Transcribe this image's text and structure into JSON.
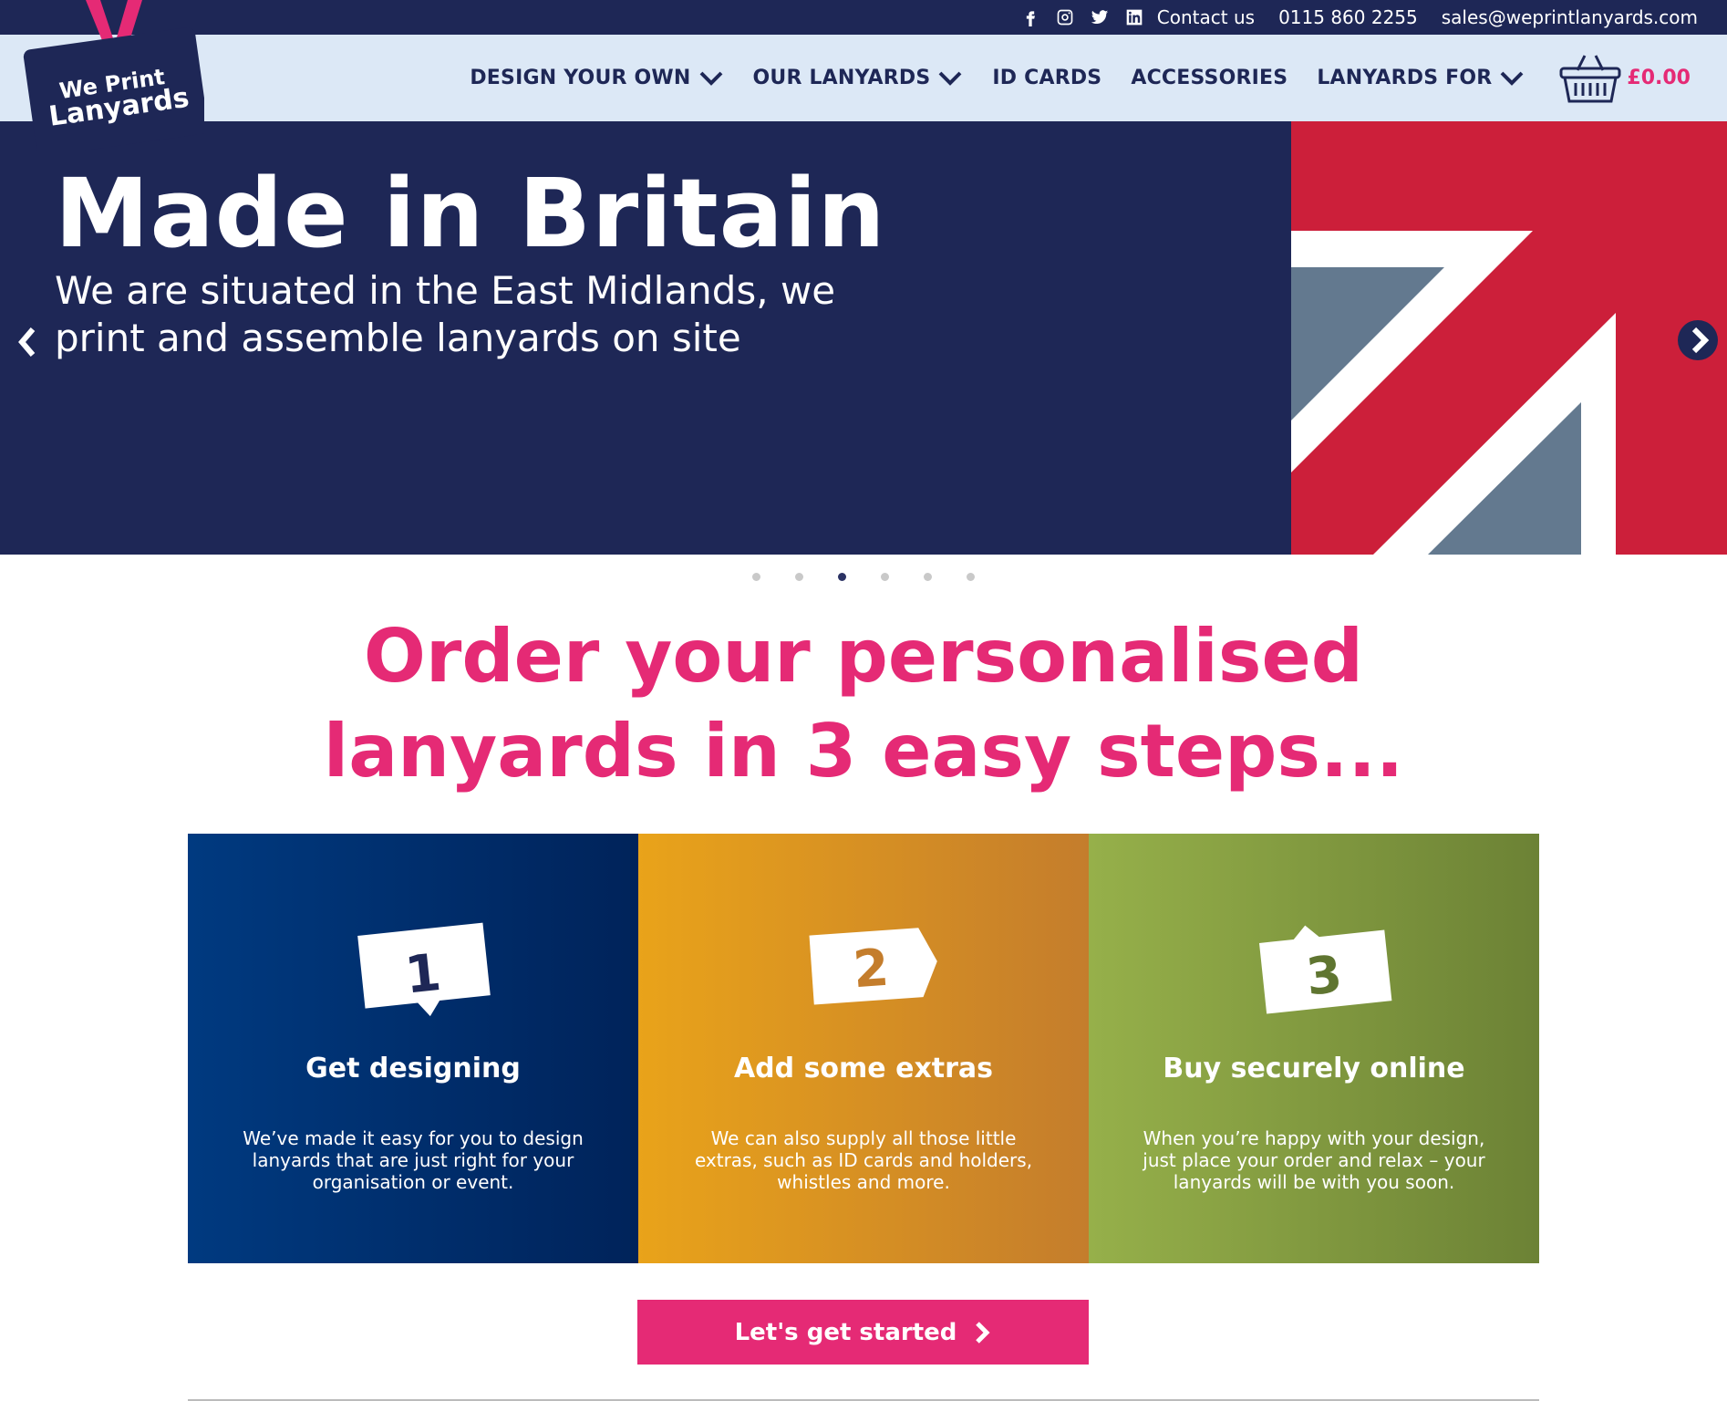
{
  "topbar": {
    "social": [
      "facebook-icon",
      "instagram-icon",
      "twitter-icon",
      "linkedin-icon"
    ],
    "contact_label": "Contact us",
    "phone": "0115 860 2255",
    "email": "sales@weprintlanyards.com"
  },
  "logo": {
    "line1": "We Print",
    "line2": "Lanyards"
  },
  "nav": {
    "items": [
      {
        "label": "DESIGN YOUR OWN",
        "dropdown": true
      },
      {
        "label": "OUR LANYARDS",
        "dropdown": true
      },
      {
        "label": "ID CARDS",
        "dropdown": false
      },
      {
        "label": "ACCESSORIES",
        "dropdown": false
      },
      {
        "label": "LANYARDS FOR",
        "dropdown": true
      }
    ],
    "cart_total": "£0.00"
  },
  "hero": {
    "title": "Made in Britain",
    "subtitle": "We are situated in the East Midlands, we print and assemble lanyards on site",
    "slide_count": 6,
    "active_slide": 3
  },
  "headline": {
    "line1": "Order your personalised",
    "line2": "lanyards in 3 easy steps..."
  },
  "steps": [
    {
      "number": "1",
      "title": "Get designing",
      "desc": "We’ve made it easy for you to design lanyards that are just right for your organisation or event."
    },
    {
      "number": "2",
      "title": "Add some extras",
      "desc": "We can also supply all those little extras, such as ID cards and holders, whistles and more."
    },
    {
      "number": "3",
      "title": "Buy securely online",
      "desc": "When you’re happy with your design, just place your order and relax – your lanyards will be with you soon."
    }
  ],
  "cta": {
    "label": "Let's get started"
  },
  "colors": {
    "navy": "#1e2756",
    "pink": "#e52a75",
    "nav_bg": "#dce8f6",
    "orange": "#e9a31a",
    "green": "#96b04a",
    "blue": "#003a80"
  }
}
